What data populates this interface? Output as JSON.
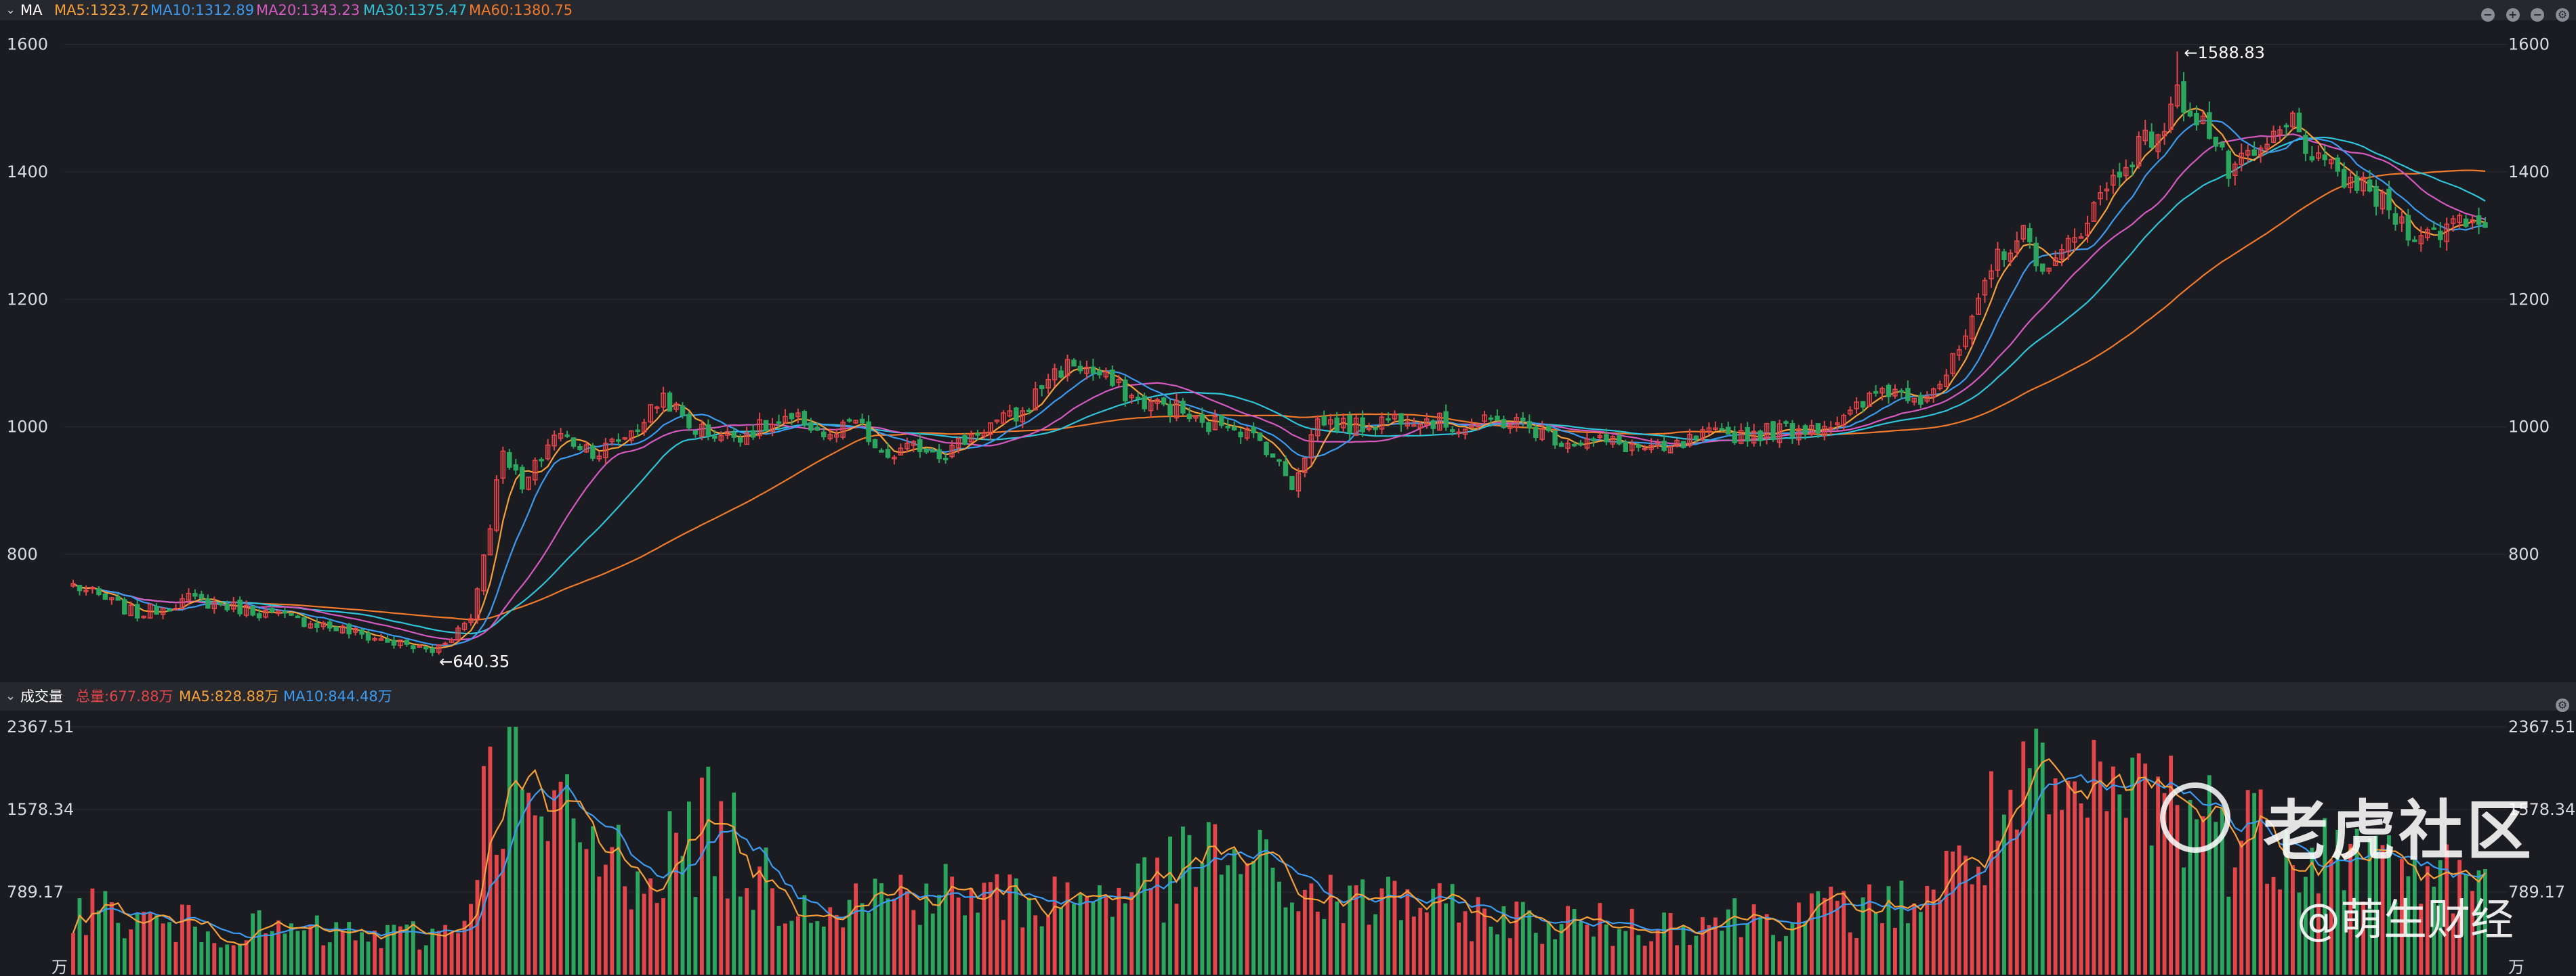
{
  "colors": {
    "up": "#e2454a",
    "down": "#2ca65e",
    "ma5": "#f6a03a",
    "ma10": "#3c9bf0",
    "ma20": "#d45ac2",
    "ma30": "#2fc4d9",
    "ma60": "#f07a2c",
    "vol_total": "#e2454a",
    "vol_ma5": "#f6a03a",
    "vol_ma10": "#3c9bf0",
    "background": "#1b1c21",
    "header_bg": "#26282e"
  },
  "header": {
    "indicator": "MA",
    "ma5": "MA5:1323.72",
    "ma10": "MA10:1312.89",
    "ma20": "MA20:1343.23",
    "ma30": "MA30:1375.47",
    "ma60": "MA60:1380.75",
    "controls": [
      "minus-circle-icon",
      "plus-circle-icon",
      "minus-circle-icon",
      "gear-icon"
    ]
  },
  "volume_header": {
    "indicator": "成交量",
    "total": "总量:677.88万",
    "ma5": "MA5:828.88万",
    "ma10": "MA10:844.48万",
    "controls": [
      "gear-icon"
    ]
  },
  "watermark": {
    "brand": "老虎社区",
    "author": "@萌生财经"
  },
  "chart_data": [
    {
      "type": "candlestick",
      "price_ticks": [
        "1600",
        "1400",
        "1200",
        "1000",
        "800"
      ],
      "price_tick_values": [
        1600,
        1400,
        1200,
        1000,
        800
      ],
      "ylim": [
        610,
        1625
      ],
      "annotations": {
        "high": "←1588.83",
        "low": "←640.35",
        "high_value": 1588.83,
        "low_value": 640.35
      },
      "anchors": [
        [
          0,
          752
        ],
        [
          10,
          706
        ],
        [
          18,
          730
        ],
        [
          28,
          712
        ],
        [
          38,
          692
        ],
        [
          48,
          666
        ],
        [
          56,
          648
        ],
        [
          62,
          700
        ],
        [
          65,
          850
        ],
        [
          67,
          970
        ],
        [
          70,
          900
        ],
        [
          75,
          990
        ],
        [
          82,
          960
        ],
        [
          88,
          1000
        ],
        [
          92,
          1050
        ],
        [
          96,
          1000
        ],
        [
          102,
          985
        ],
        [
          108,
          1000
        ],
        [
          114,
          1010
        ],
        [
          118,
          980
        ],
        [
          122,
          1010
        ],
        [
          126,
          950
        ],
        [
          132,
          970
        ],
        [
          136,
          960
        ],
        [
          142,
          1000
        ],
        [
          148,
          1020
        ],
        [
          152,
          1080
        ],
        [
          156,
          1100
        ],
        [
          160,
          1080
        ],
        [
          166,
          1040
        ],
        [
          172,
          1030
        ],
        [
          176,
          1000
        ],
        [
          180,
          1010
        ],
        [
          186,
          970
        ],
        [
          190,
          910
        ],
        [
          194,
          1010
        ],
        [
          200,
          1000
        ],
        [
          208,
          1020
        ],
        [
          216,
          1000
        ],
        [
          224,
          1010
        ],
        [
          232,
          980
        ],
        [
          240,
          975
        ],
        [
          248,
          960
        ],
        [
          254,
          985
        ],
        [
          262,
          990
        ],
        [
          270,
          1000
        ],
        [
          276,
          1010
        ],
        [
          282,
          1060
        ],
        [
          288,
          1050
        ],
        [
          292,
          1080
        ],
        [
          296,
          1160
        ],
        [
          300,
          1270
        ],
        [
          304,
          1300
        ],
        [
          308,
          1240
        ],
        [
          312,
          1300
        ],
        [
          318,
          1390
        ],
        [
          322,
          1440
        ],
        [
          326,
          1470
        ],
        [
          328,
          1520
        ],
        [
          332,
          1480
        ],
        [
          336,
          1400
        ],
        [
          340,
          1420
        ],
        [
          346,
          1480
        ],
        [
          350,
          1410
        ],
        [
          356,
          1380
        ],
        [
          360,
          1350
        ],
        [
          364,
          1310
        ],
        [
          368,
          1300
        ],
        [
          372,
          1330
        ],
        [
          376,
          1320
        ]
      ],
      "last_close": 1313
    },
    {
      "type": "bar",
      "volume_ticks": [
        "2367.51",
        "1578.34",
        "789.17"
      ],
      "volume_tick_values": [
        2367.51,
        1578.34,
        789.17
      ],
      "unit": "万",
      "ylim": [
        0,
        2470
      ],
      "vol_anchors": [
        [
          0,
          700
        ],
        [
          10,
          500
        ],
        [
          30,
          420
        ],
        [
          50,
          360
        ],
        [
          60,
          420
        ],
        [
          65,
          1800
        ],
        [
          68,
          2300
        ],
        [
          72,
          1300
        ],
        [
          78,
          1450
        ],
        [
          82,
          1100
        ],
        [
          90,
          1050
        ],
        [
          94,
          1200
        ],
        [
          100,
          1450
        ],
        [
          106,
          950
        ],
        [
          112,
          750
        ],
        [
          120,
          700
        ],
        [
          132,
          820
        ],
        [
          138,
          750
        ],
        [
          150,
          700
        ],
        [
          162,
          800
        ],
        [
          170,
          880
        ],
        [
          178,
          1150
        ],
        [
          182,
          1100
        ],
        [
          190,
          800
        ],
        [
          196,
          700
        ],
        [
          200,
          650
        ],
        [
          206,
          780
        ],
        [
          212,
          620
        ],
        [
          220,
          560
        ],
        [
          230,
          500
        ],
        [
          240,
          470
        ],
        [
          250,
          500
        ],
        [
          262,
          560
        ],
        [
          274,
          600
        ],
        [
          282,
          620
        ],
        [
          290,
          820
        ],
        [
          296,
          1100
        ],
        [
          300,
          1500
        ],
        [
          306,
          1650
        ],
        [
          312,
          1500
        ],
        [
          318,
          1700
        ],
        [
          324,
          1750
        ],
        [
          330,
          1600
        ],
        [
          336,
          1350
        ],
        [
          344,
          1350
        ],
        [
          352,
          1200
        ],
        [
          360,
          1050
        ],
        [
          368,
          950
        ],
        [
          376,
          800
        ]
      ]
    }
  ]
}
